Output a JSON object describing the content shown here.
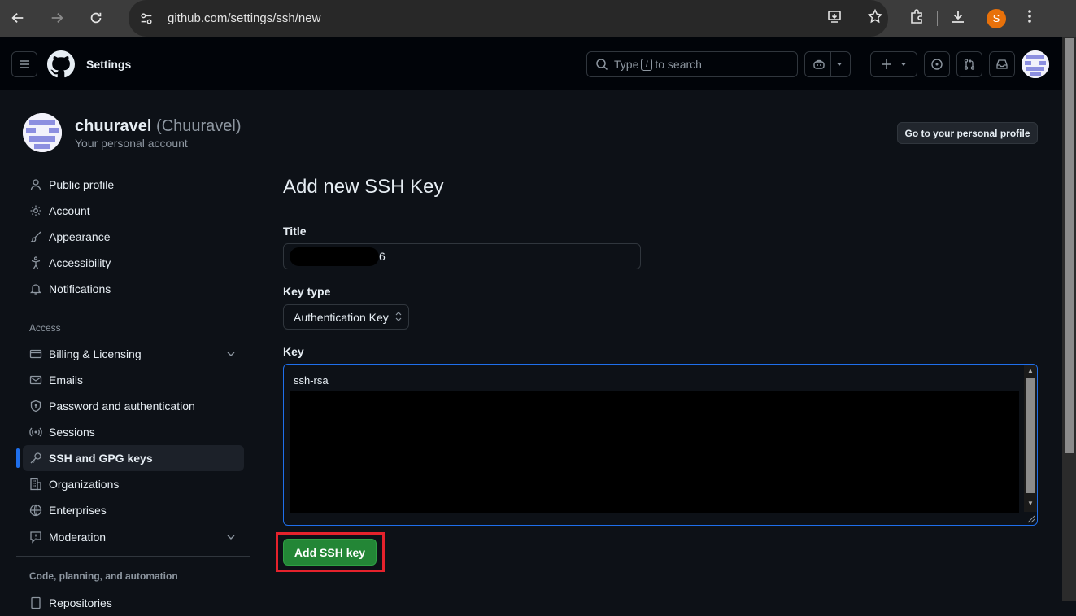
{
  "browser": {
    "url": "github.com/settings/ssh/new",
    "profile_initial": "S"
  },
  "header": {
    "context_title": "Settings",
    "search": {
      "prefix": "Type",
      "key": "/",
      "suffix": "to search"
    }
  },
  "profile": {
    "username": "chuuravel",
    "handle": "(Chuuravel)",
    "subtitle": "Your personal account",
    "go_profile_label": "Go to your personal profile"
  },
  "sidebar": {
    "items": [
      {
        "label": "Public profile",
        "icon": "person-icon"
      },
      {
        "label": "Account",
        "icon": "gear-icon"
      },
      {
        "label": "Appearance",
        "icon": "paintbrush-icon"
      },
      {
        "label": "Accessibility",
        "icon": "accessibility-icon"
      },
      {
        "label": "Notifications",
        "icon": "bell-icon"
      }
    ],
    "access_heading": "Access",
    "access_items": [
      {
        "label": "Billing & Licensing",
        "icon": "credit-card-icon",
        "expandable": true
      },
      {
        "label": "Emails",
        "icon": "mail-icon"
      },
      {
        "label": "Password and authentication",
        "icon": "shield-lock-icon"
      },
      {
        "label": "Sessions",
        "icon": "broadcast-icon"
      },
      {
        "label": "SSH and GPG keys",
        "icon": "key-icon",
        "active": true
      },
      {
        "label": "Organizations",
        "icon": "organization-icon"
      },
      {
        "label": "Enterprises",
        "icon": "globe-icon"
      },
      {
        "label": "Moderation",
        "icon": "report-icon",
        "expandable": true
      }
    ],
    "code_heading": "Code, planning, and automation",
    "partial_item": "Repositories"
  },
  "form": {
    "page_title": "Add new SSH Key",
    "title_label": "Title",
    "title_value_visible_tail": "6",
    "key_type_label": "Key type",
    "key_type_value": "Authentication Key",
    "key_label": "Key",
    "key_value_visible": "ssh-rsa",
    "submit_label": "Add SSH key"
  },
  "colors": {
    "accent": "#1f6feb",
    "primary_button": "#238636",
    "highlight": "#e5222c"
  }
}
